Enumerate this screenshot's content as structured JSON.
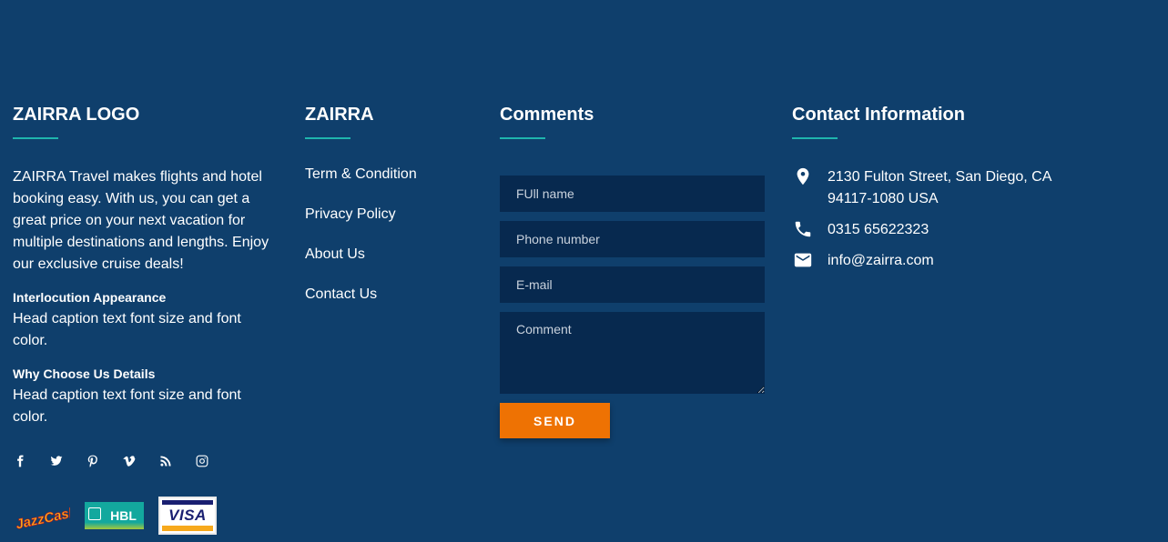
{
  "logo_column": {
    "heading": "ZAIRRA LOGO",
    "about": "ZAIRRA Travel makes flights and hotel booking easy. With us, you can get a great price on your next vacation for multiple destinations and lengths. Enjoy our exclusive cruise deals!",
    "sections": [
      {
        "title": "Interlocution Appearance",
        "text": "Head caption text font size and font color."
      },
      {
        "title": "Why Choose Us Details",
        "text": "Head caption text font size and font color."
      }
    ],
    "social_icons": [
      "facebook-icon",
      "twitter-icon",
      "pinterest-icon",
      "vimeo-icon",
      "rss-icon",
      "instagram-icon"
    ],
    "payments": {
      "jazzcash": "JazzCash",
      "hbl": "HBL",
      "visa": "VISA"
    }
  },
  "links_column": {
    "heading": "ZAIRRA",
    "links": [
      "Term & Condition",
      "Privacy Policy",
      "About Us",
      "Contact Us"
    ]
  },
  "comments_column": {
    "heading": "Comments",
    "fields": {
      "full_name": {
        "placeholder": "FUll name",
        "value": ""
      },
      "phone": {
        "placeholder": "Phone number",
        "value": ""
      },
      "email": {
        "placeholder": "E-mail",
        "value": ""
      },
      "comment": {
        "placeholder": "Comment",
        "value": ""
      }
    },
    "send_label": "SEND"
  },
  "contact_column": {
    "heading": "Contact Information",
    "address_line1": "2130 Fulton Street, San Diego, CA",
    "address_line2": "94117-1080 USA",
    "phone": "0315 65622323",
    "email": "info@zairra.com"
  },
  "colors": {
    "background": "#0f3f6c",
    "accent_underline": "#1fb5ad",
    "input_background": "#07294f",
    "send_button": "#ee7203"
  }
}
